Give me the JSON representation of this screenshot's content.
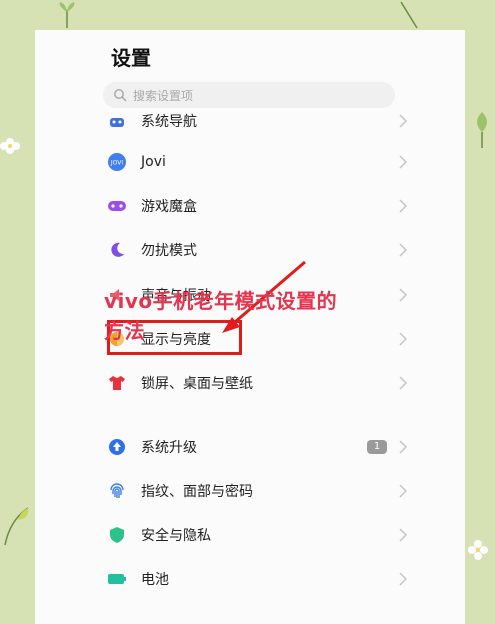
{
  "header": {
    "title": "设置"
  },
  "search": {
    "placeholder": "搜索设置项"
  },
  "items": [
    {
      "id": "system-nav",
      "label": "系统导航",
      "color": "#3f6fe0"
    },
    {
      "id": "jovi",
      "label": "Jovi",
      "color": "#3f7ff0"
    },
    {
      "id": "game-box",
      "label": "游戏魔盒",
      "color": "#9b4fe6"
    },
    {
      "id": "dnd",
      "label": "勿扰模式",
      "color": "#7e4fe6"
    },
    {
      "id": "sound",
      "label": "声音与振动",
      "color": "#ef5a6a"
    },
    {
      "id": "display",
      "label": "显示与亮度",
      "color": "#f2a12a"
    },
    {
      "id": "lockscreen",
      "label": "锁屏、桌面与壁纸",
      "color": "#e8333f"
    },
    {
      "id": "update",
      "label": "系统升级",
      "color": "#2f6fe8",
      "badge": "1"
    },
    {
      "id": "fingerprint",
      "label": "指纹、面部与密码",
      "color": "#3a7fe8"
    },
    {
      "id": "security",
      "label": "安全与隐私",
      "color": "#2fc18a"
    },
    {
      "id": "battery",
      "label": "电池",
      "color": "#20c0a0"
    }
  ],
  "annotation": {
    "line1": "vivo手机老年模式设置的",
    "line2": "方法",
    "color": "#e5354e"
  }
}
